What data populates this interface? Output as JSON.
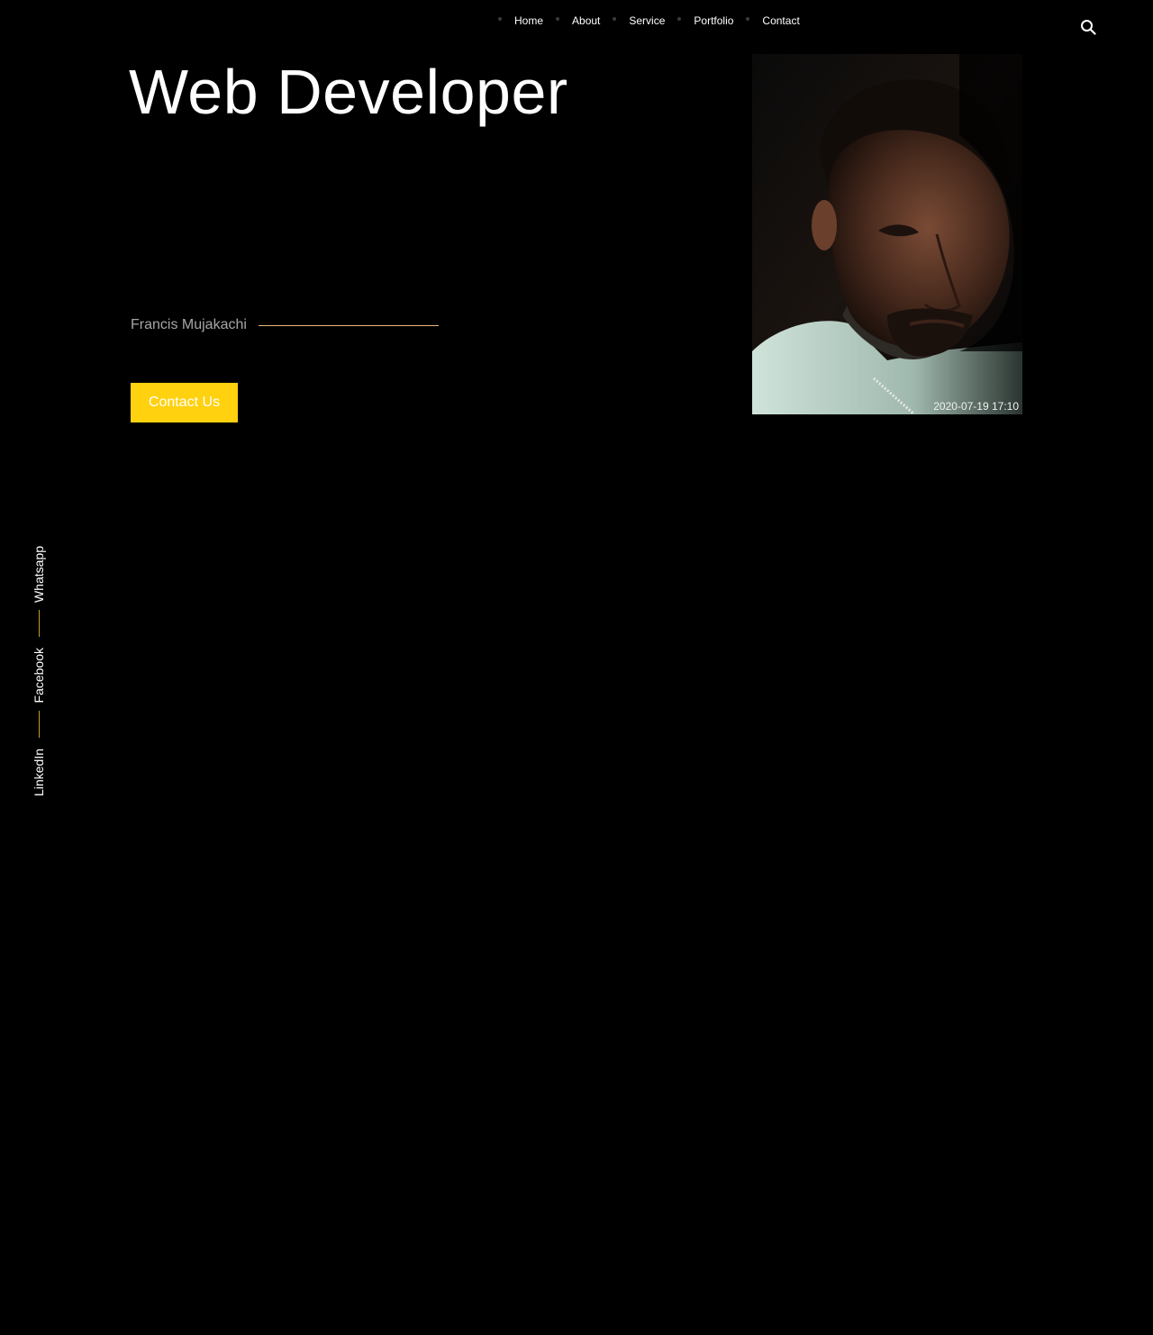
{
  "nav": {
    "items": [
      {
        "label": "Home"
      },
      {
        "label": "About"
      },
      {
        "label": "Service"
      },
      {
        "label": "Portfolio"
      },
      {
        "label": "Contact"
      }
    ]
  },
  "hero": {
    "title": "Web Developer",
    "author": "Francis Mujakachi",
    "cta_label": "Contact Us"
  },
  "photo": {
    "timestamp": "2020-07-19 17:10"
  },
  "social": {
    "links": [
      {
        "label": "Whatsapp"
      },
      {
        "label": "Facebook"
      },
      {
        "label": "LinkedIn"
      }
    ]
  },
  "colors": {
    "background": "#000000",
    "accent": "#ffd10f",
    "line": "#e7b77d",
    "muted_text": "#a6a6a6"
  },
  "icons": {
    "search": "search-icon"
  }
}
